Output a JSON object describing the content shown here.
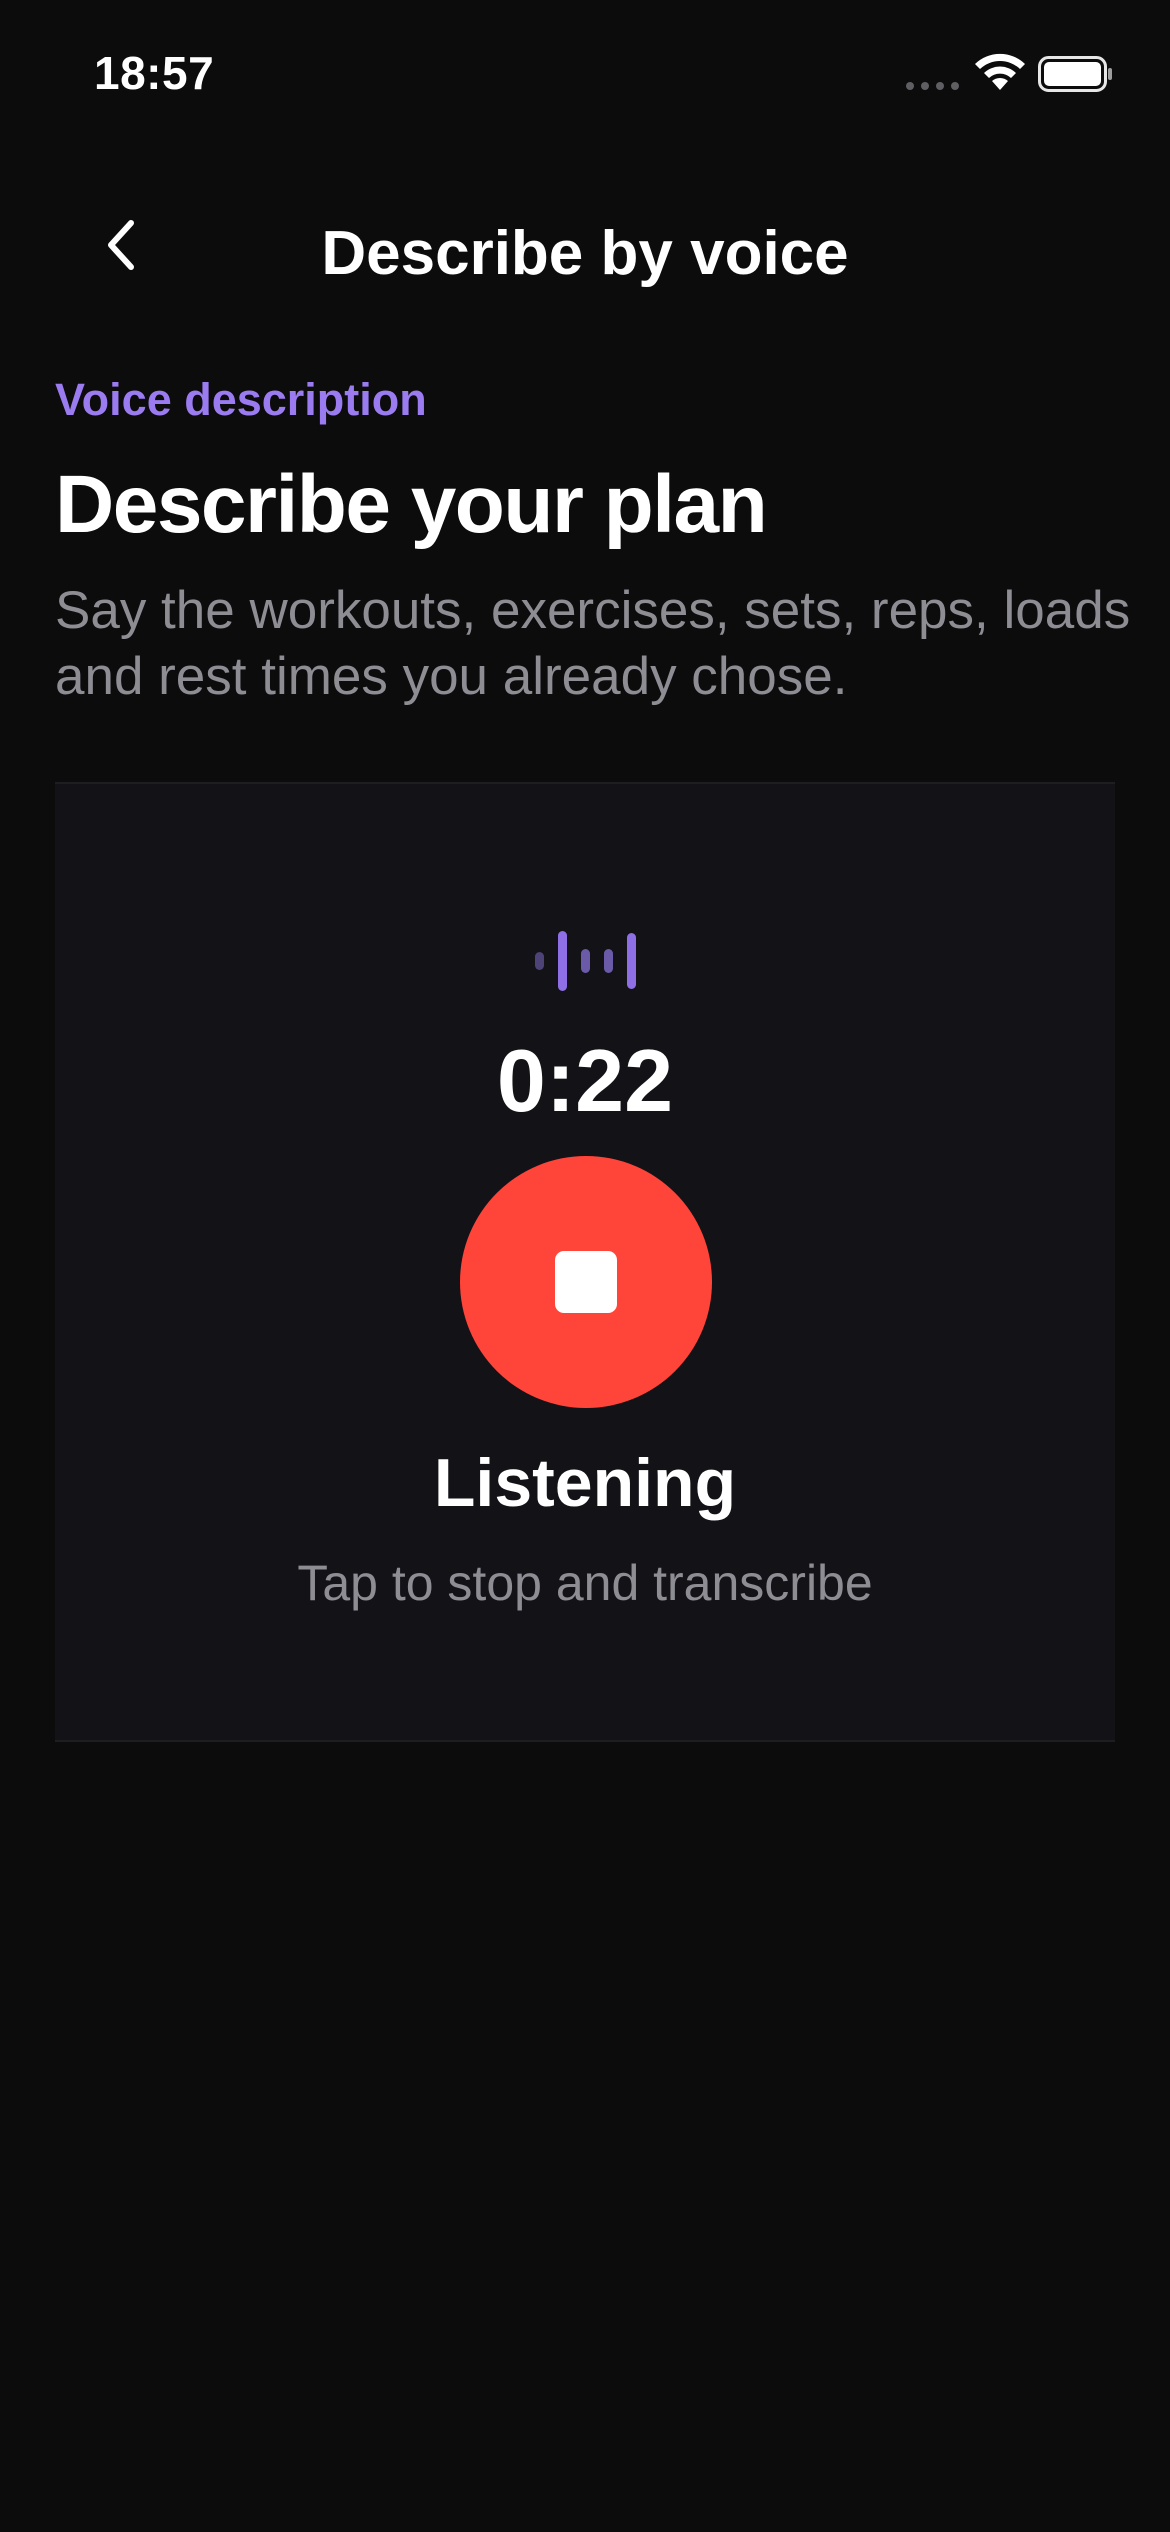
{
  "status_bar": {
    "time": "18:57",
    "wifi_icon": "wifi-icon",
    "battery_icon": "battery-icon"
  },
  "nav": {
    "back_icon": "chevron-left-icon",
    "title": "Describe by voice"
  },
  "header": {
    "eyebrow": "Voice description",
    "title": "Describe your plan",
    "subtitle": "Say the workouts, exercises, sets, reps, loads and rest times you already chose."
  },
  "recorder": {
    "waveform_icon": "waveform-icon",
    "elapsed": "0:22",
    "stop_icon": "stop-icon",
    "status": "Listening",
    "hint": "Tap to stop and transcribe"
  },
  "colors": {
    "background": "#0c0c0d",
    "card": "#121217",
    "accent": "#9b7bf0",
    "record": "#ff4439",
    "secondary_text": "#8d8d93"
  }
}
